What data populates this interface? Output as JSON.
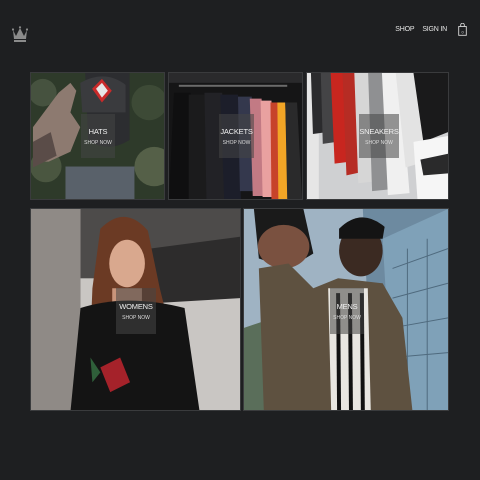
{
  "header": {
    "logo_icon": "crown-icon",
    "nav": {
      "shop": "SHOP",
      "sign_in": "SIGN IN",
      "bag_icon": "shopping-bag-icon"
    }
  },
  "categories": [
    {
      "title": "HATS",
      "cta": "SHOP NOW"
    },
    {
      "title": "JACKETS",
      "cta": "SHOP NOW"
    },
    {
      "title": "SNEAKERS",
      "cta": "SHOP NOW"
    },
    {
      "title": "WOMENS",
      "cta": "SHOP NOW"
    },
    {
      "title": "MENS",
      "cta": "SHOP NOW"
    }
  ],
  "colors": {
    "background": "#1e1f21",
    "text": "#e8e8e8",
    "label_overlay": "rgba(70,70,70,0.55)"
  }
}
